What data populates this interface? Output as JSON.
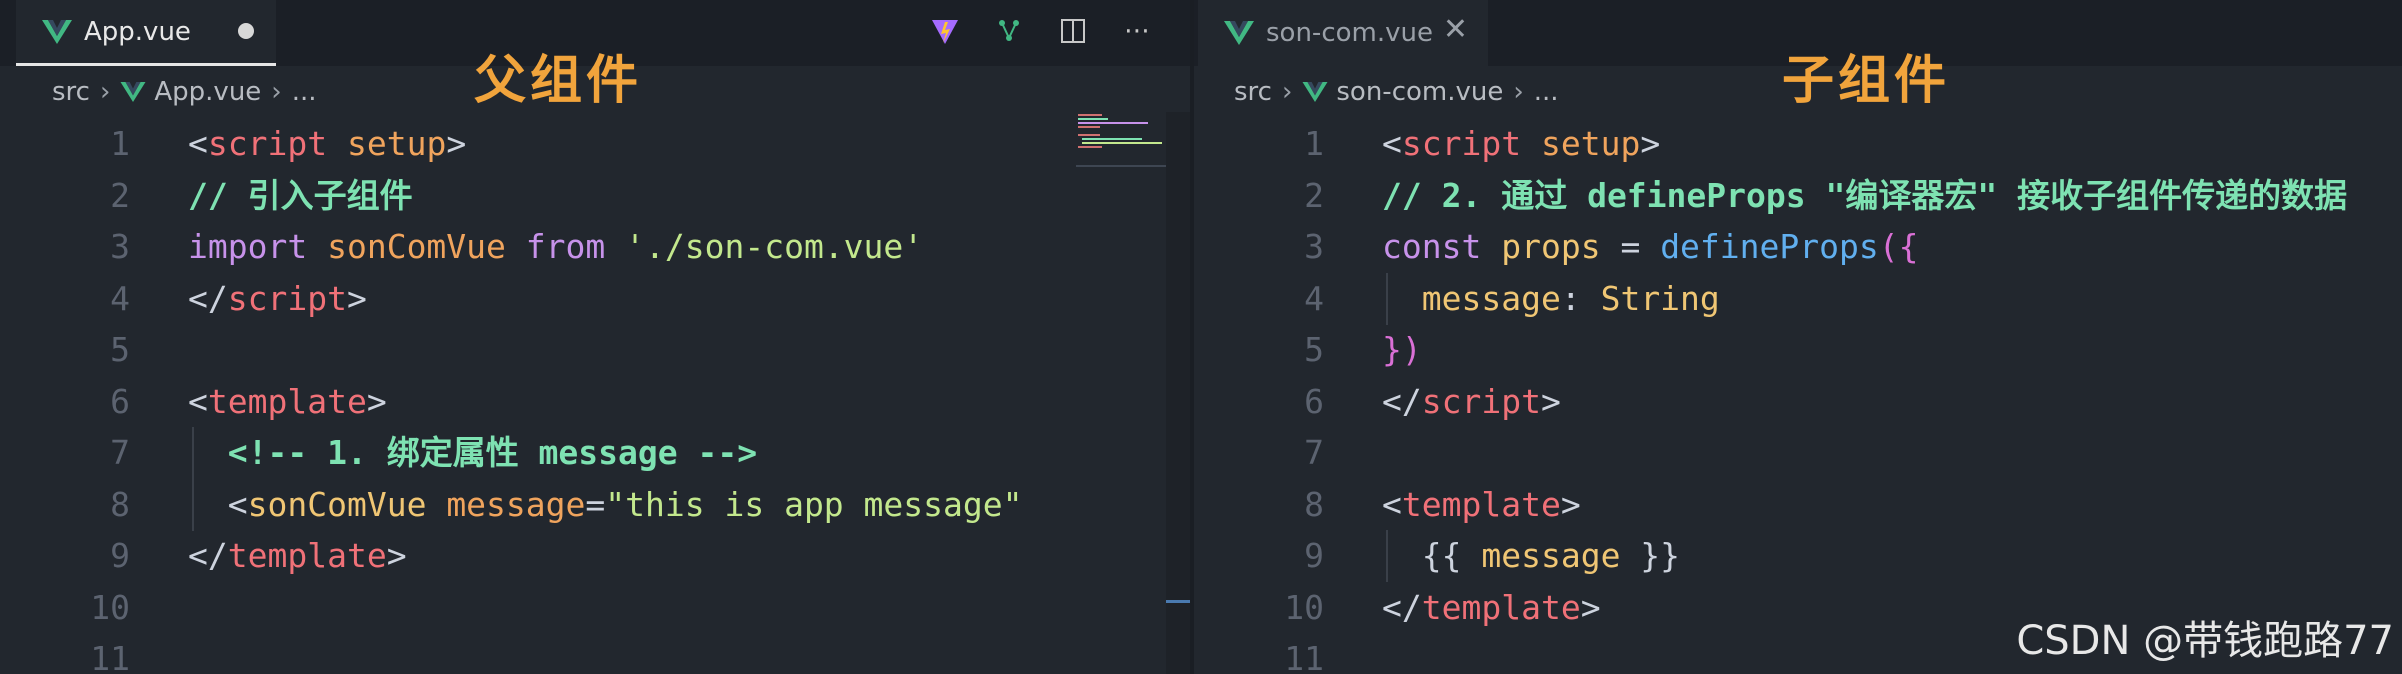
{
  "left": {
    "tab": {
      "label": "App.vue",
      "icon": "vue-logo-icon"
    },
    "annotation": "父组件",
    "breadcrumb": [
      "src",
      "App.vue",
      "..."
    ],
    "lines": [
      {
        "n": "1",
        "tokens": [
          [
            "punct",
            "<"
          ],
          [
            "tag",
            "script"
          ],
          [
            "plain",
            " "
          ],
          [
            "attr",
            "setup"
          ],
          [
            "punct",
            ">"
          ]
        ]
      },
      {
        "n": "2",
        "tokens": [
          [
            "comment",
            "// 引入子组件"
          ]
        ]
      },
      {
        "n": "3",
        "tokens": [
          [
            "kw",
            "import"
          ],
          [
            "plain",
            " "
          ],
          [
            "id",
            "sonComVue"
          ],
          [
            "plain",
            " "
          ],
          [
            "kw",
            "from"
          ],
          [
            "plain",
            " "
          ],
          [
            "str",
            "'./son-com.vue'"
          ]
        ]
      },
      {
        "n": "4",
        "tokens": [
          [
            "punct",
            "</"
          ],
          [
            "tag",
            "script"
          ],
          [
            "punct",
            ">"
          ]
        ]
      },
      {
        "n": "5",
        "tokens": []
      },
      {
        "n": "6",
        "tokens": [
          [
            "punct",
            "<"
          ],
          [
            "tag",
            "template"
          ],
          [
            "punct",
            ">"
          ]
        ]
      },
      {
        "n": "7",
        "guide": true,
        "tokens": [
          [
            "plain",
            "  "
          ],
          [
            "comment",
            "<!-- 1. 绑定属性 message -->"
          ]
        ]
      },
      {
        "n": "8",
        "guide": true,
        "tokens": [
          [
            "plain",
            "  "
          ],
          [
            "punct",
            "<"
          ],
          [
            "prop",
            "sonComVue"
          ],
          [
            "plain",
            " "
          ],
          [
            "attr",
            "message"
          ],
          [
            "punct",
            "="
          ],
          [
            "str",
            "\"this is app message\""
          ]
        ]
      },
      {
        "n": "9",
        "tokens": [
          [
            "punct",
            "</"
          ],
          [
            "tag",
            "template"
          ],
          [
            "punct",
            ">"
          ]
        ]
      },
      {
        "n": "10",
        "tokens": []
      },
      {
        "n": "11",
        "tokens": []
      }
    ]
  },
  "right": {
    "tab": {
      "label": "son-com.vue",
      "icon": "vue-logo-icon"
    },
    "annotation": "子组件",
    "breadcrumb": [
      "src",
      "son-com.vue",
      "..."
    ],
    "lines": [
      {
        "n": "1",
        "tokens": [
          [
            "punct",
            "<"
          ],
          [
            "tag",
            "script"
          ],
          [
            "plain",
            " "
          ],
          [
            "attr",
            "setup"
          ],
          [
            "punct",
            ">"
          ]
        ]
      },
      {
        "n": "2",
        "tokens": [
          [
            "comment",
            "// 2. 通过 defineProps \"编译器宏\" 接收子组件传递的数据"
          ]
        ]
      },
      {
        "n": "3",
        "tokens": [
          [
            "kw",
            "const"
          ],
          [
            "plain",
            " "
          ],
          [
            "prop",
            "props"
          ],
          [
            "plain",
            " "
          ],
          [
            "punct",
            "="
          ],
          [
            "plain",
            " "
          ],
          [
            "fn",
            "defineProps"
          ],
          [
            "brace",
            "({"
          ]
        ]
      },
      {
        "n": "4",
        "guide": true,
        "tokens": [
          [
            "plain",
            "  "
          ],
          [
            "prop",
            "message"
          ],
          [
            "punct",
            ": "
          ],
          [
            "prop",
            "String"
          ]
        ]
      },
      {
        "n": "5",
        "tokens": [
          [
            "brace",
            "})"
          ]
        ]
      },
      {
        "n": "6",
        "tokens": [
          [
            "punct",
            "</"
          ],
          [
            "tag",
            "script"
          ],
          [
            "punct",
            ">"
          ]
        ]
      },
      {
        "n": "7",
        "tokens": []
      },
      {
        "n": "8",
        "tokens": [
          [
            "punct",
            "<"
          ],
          [
            "tag",
            "template"
          ],
          [
            "punct",
            ">"
          ]
        ]
      },
      {
        "n": "9",
        "guide": true,
        "tokens": [
          [
            "plain",
            "  "
          ],
          [
            "punct",
            "{{ "
          ],
          [
            "prop",
            "message"
          ],
          [
            "punct",
            " }}"
          ]
        ]
      },
      {
        "n": "10",
        "tokens": [
          [
            "punct",
            "</"
          ],
          [
            "tag",
            "template"
          ],
          [
            "punct",
            ">"
          ]
        ]
      },
      {
        "n": "11",
        "tokens": []
      }
    ]
  },
  "watermark": "CSDN @带钱跑路77",
  "colors": {
    "editor_bg": "#22272e",
    "tag": "#f07178",
    "attribute": "#f0a45d",
    "keyword": "#c792ea",
    "string": "#c3e88d",
    "comment": "#7ee2b2",
    "function": "#61afef",
    "annotation": "#f1a43c"
  }
}
